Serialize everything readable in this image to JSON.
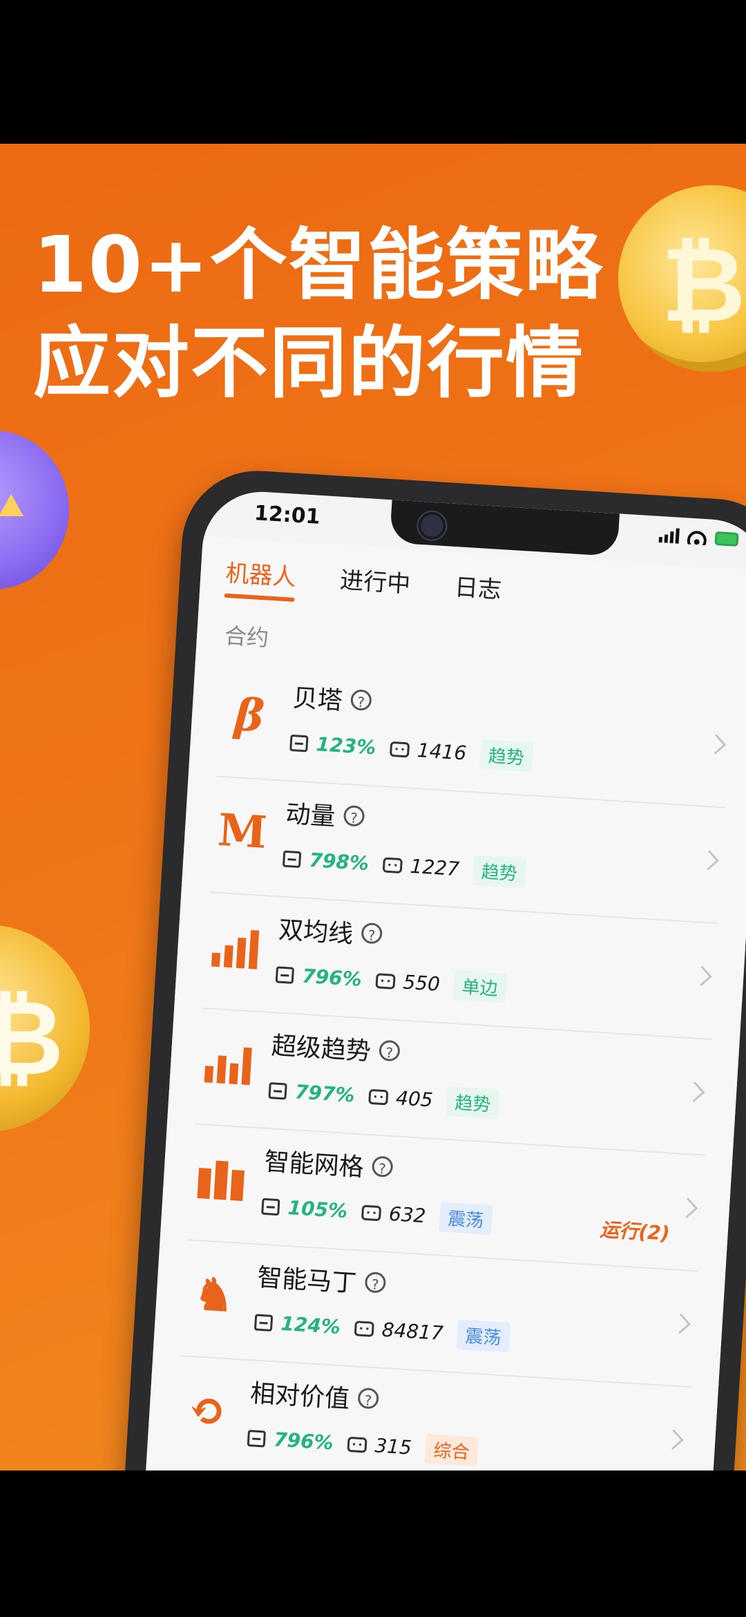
{
  "headline": {
    "line1": "10+个智能策略",
    "line2": "应对不同的行情"
  },
  "status": {
    "time": "12:01"
  },
  "tabs": [
    {
      "label": "机器人",
      "active": true
    },
    {
      "label": "进行中",
      "active": false
    },
    {
      "label": "日志",
      "active": false
    }
  ],
  "section_title": "合约",
  "help_glyph": "?",
  "strategies": [
    {
      "icon": "beta-icon",
      "glyph": "β",
      "name": "贝塔",
      "roi": "123%",
      "bots": "1416",
      "tag": "趋势",
      "tag_type": "trend"
    },
    {
      "icon": "momentum-icon",
      "glyph": "M",
      "name": "动量",
      "roi": "798%",
      "bots": "1227",
      "tag": "趋势",
      "tag_type": "trend"
    },
    {
      "icon": "dual-ma-icon",
      "glyph": "",
      "name": "双均线",
      "roi": "796%",
      "bots": "550",
      "tag": "单边",
      "tag_type": "trend"
    },
    {
      "icon": "super-trend-icon",
      "glyph": "",
      "name": "超级趋势",
      "roi": "797%",
      "bots": "405",
      "tag": "趋势",
      "tag_type": "trend"
    },
    {
      "icon": "grid-icon",
      "glyph": "",
      "name": "智能网格",
      "roi": "105%",
      "bots": "632",
      "tag": "震荡",
      "tag_type": "osc",
      "running": "运行(2)"
    },
    {
      "icon": "martingale-icon",
      "glyph": "♞",
      "name": "智能马丁",
      "roi": "124%",
      "bots": "84817",
      "tag": "震荡",
      "tag_type": "osc"
    },
    {
      "icon": "relative-value-icon",
      "glyph": "⟲",
      "name": "相对价值",
      "roi": "796%",
      "bots": "315",
      "tag": "综合",
      "tag_type": "mix"
    }
  ],
  "colors": {
    "accent": "#e8641a",
    "positive": "#24b47e",
    "background": "#ef7417"
  }
}
